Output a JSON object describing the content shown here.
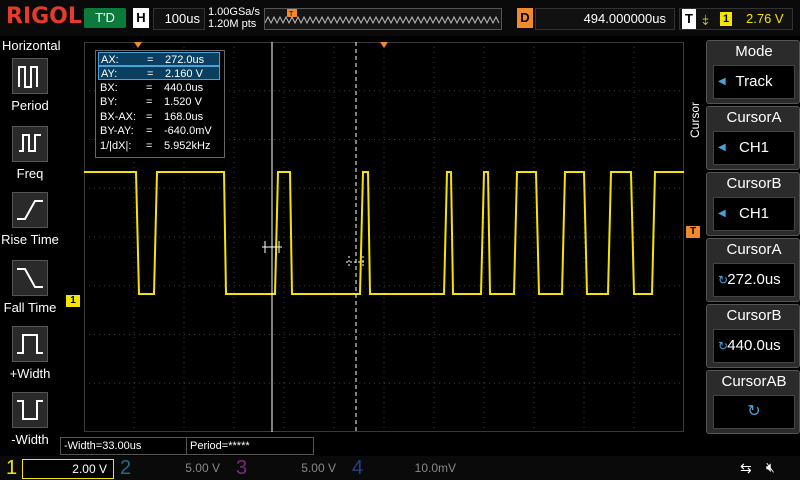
{
  "header": {
    "logo": "RIGOL",
    "trigger_status": "T'D",
    "timebase_label": "H",
    "timebase_value": "100us",
    "sample_rate": "1.00GSa/s",
    "memory_depth": "1.20M pts",
    "delay_label": "D",
    "delay_value": "494.000000us",
    "trigger_label": "T",
    "trigger_channel": "1",
    "trigger_level": "2.76 V"
  },
  "left_menu": {
    "title": "Horizontal",
    "items": [
      {
        "label": "Period",
        "icon": "period-icon"
      },
      {
        "label": "Freq",
        "icon": "frequency-icon"
      },
      {
        "label": "Rise Time",
        "icon": "rise-time-icon"
      },
      {
        "label": "Fall Time",
        "icon": "fall-time-icon"
      },
      {
        "label": "+Width",
        "icon": "positive-width-icon"
      },
      {
        "label": "-Width",
        "icon": "negative-width-icon"
      }
    ]
  },
  "cursor_info": [
    {
      "key": "AX:",
      "eq": "=",
      "val": "272.0us"
    },
    {
      "key": "AY:",
      "eq": "=",
      "val": "2.160 V"
    },
    {
      "key": "BX:",
      "eq": "=",
      "val": "440.0us"
    },
    {
      "key": "BY:",
      "eq": "=",
      "val": "1.520 V"
    },
    {
      "key": "BX-AX:",
      "eq": "=",
      "val": "168.0us"
    },
    {
      "key": "BY-AY:",
      "eq": "=",
      "val": "-640.0mV"
    },
    {
      "key": "1/|dX|:",
      "eq": "=",
      "val": "5.952kHz"
    }
  ],
  "measurements": {
    "neg_width": "-Width=33.00us",
    "period": "Period=*****"
  },
  "channels": [
    {
      "num": "1",
      "scale": "2.00 V",
      "color": "#f5e400"
    },
    {
      "num": "2",
      "scale": "5.00 V",
      "color": "#2fb8d8"
    },
    {
      "num": "3",
      "scale": "5.00 V",
      "color": "#d040d0"
    },
    {
      "num": "4",
      "scale": "10.0mV",
      "color": "#3b6cff"
    }
  ],
  "right_menu": {
    "vertical_label": "Cursor",
    "buttons": [
      {
        "title": "Mode",
        "value": "Track"
      },
      {
        "title": "CursorA",
        "value": "CH1"
      },
      {
        "title": "CursorB",
        "value": "CH1"
      },
      {
        "title": "CursorA",
        "value": "272.0us"
      },
      {
        "title": "CursorB",
        "value": "440.0us"
      },
      {
        "title": "CursorAB",
        "value": ""
      }
    ]
  },
  "colors": {
    "ch1": "#f5e400",
    "grid": "#3a3a3a",
    "accent": "#f08a2a",
    "highlight": "#4aa3d8"
  },
  "markers": {
    "ch1_ground": "1",
    "trigger_arrow": "T"
  },
  "chart_data": {
    "type": "line",
    "series": [
      {
        "name": "1",
        "x": [
          0,
          52,
          55,
          70,
          73,
          140,
          142,
          191,
          194,
          206,
          208,
          276,
          279,
          284,
          286,
          360,
          363,
          367,
          369,
          397,
          400,
          404,
          406,
          430,
          433,
          452,
          455,
          478,
          481,
          500,
          503,
          524,
          527,
          547,
          550,
          568,
          571,
          600
        ],
        "y": [
          2.8,
          2.8,
          -0.8,
          -0.8,
          2.8,
          2.8,
          -0.8,
          -0.8,
          2.8,
          2.8,
          -0.8,
          -0.8,
          2.8,
          2.8,
          -0.8,
          -0.8,
          2.8,
          2.8,
          -0.8,
          -0.8,
          2.8,
          2.8,
          -0.8,
          -0.8,
          2.8,
          2.8,
          -0.8,
          -0.8,
          2.8,
          2.8,
          -0.8,
          -0.8,
          2.8,
          2.8,
          -0.8,
          -0.8,
          2.8,
          2.8
        ]
      }
    ]
  }
}
